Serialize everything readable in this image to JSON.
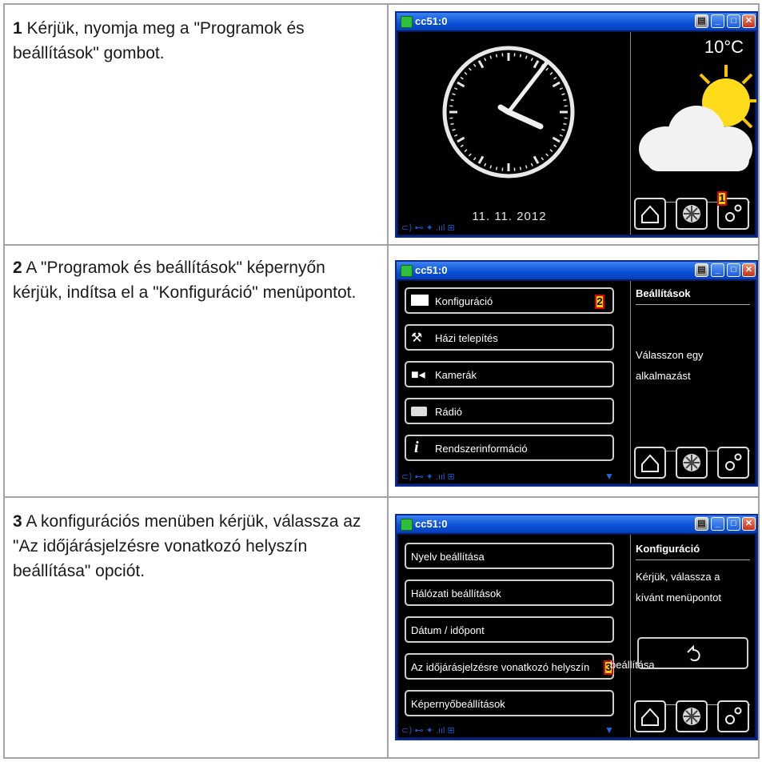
{
  "rows": [
    {
      "step": "1",
      "text": " Kérjük, nyomja meg a \"Programok és beállítások\" gombot.",
      "window": {
        "title": "cc51:0",
        "temperature": "10°C",
        "date": "11. 11. 2012",
        "marker": "1"
      }
    },
    {
      "step": "2",
      "text": " A \"Programok és beállítások\" képer­nyőn kérjük, indítsa el a \"Konfiguráció\" menüpontot.",
      "window": {
        "title": "cc51:0",
        "menu": [
          "Konfiguráció",
          "Házi telepítés",
          "Kamerák",
          "Rádió",
          "Rendszerinformáció"
        ],
        "right_title": "Beállítások",
        "right_text_1": "Válasszon egy",
        "right_text_2": "alkalmazást",
        "marker": "2"
      }
    },
    {
      "step": "3",
      "text": " A konfigurációs menüben kérjük, vá­lassza az \"Az időjárásjelzésre vonatkozó helyszín beállítása\" opciót.",
      "window": {
        "title": "cc51:0",
        "menu": [
          "Nyelv beállítása",
          "Hálózati beállítások",
          "Dátum / időpont",
          "Az időjárásjelzésre vonatkozó helyszín",
          "Képernyőbeállítások"
        ],
        "menu_overflow": "beállítása",
        "right_title": "Konfiguráció",
        "right_text_1": "Kérjük, válassza a",
        "right_text_2": "kívánt menüpontot",
        "marker": "3"
      }
    }
  ],
  "icons": {
    "home": "home-icon",
    "program": "program-icon",
    "settings": "gear-icon",
    "back": "back-icon"
  }
}
